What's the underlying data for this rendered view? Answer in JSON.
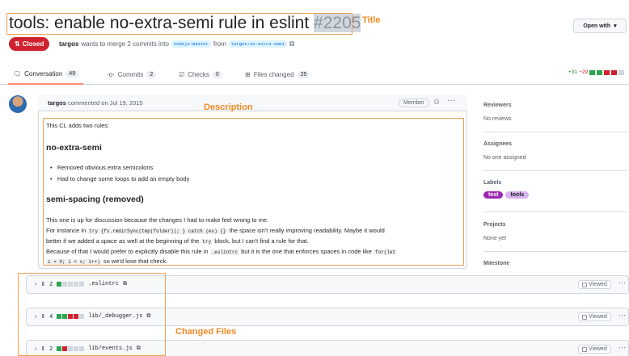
{
  "annotations": {
    "title": "Title",
    "description": "Description",
    "changed_files": "Changed Files"
  },
  "header": {
    "title": "tools: enable no-extra-semi rule in eslint",
    "number": "#2205",
    "open_with": "Open with",
    "status": "Closed",
    "author": "targos",
    "merge_text": "wants to merge 2 commits into",
    "base_branch": "nodejs:master",
    "from_text": "from",
    "head_branch": "targos:no-extra-semi"
  },
  "tabs": [
    {
      "label": "Conversation",
      "count": "49",
      "icon": "comment-icon"
    },
    {
      "label": "Commits",
      "count": "2",
      "icon": "commit-icon"
    },
    {
      "label": "Checks",
      "count": "0",
      "icon": "checks-icon"
    },
    {
      "label": "Files changed",
      "count": "25",
      "icon": "file-diff-icon"
    }
  ],
  "diffstat": {
    "additions": "+31",
    "deletions": "−29"
  },
  "comment": {
    "author": "targos",
    "action": "commented on Jul 19, 2015",
    "role": "Member",
    "intro": "This CL adds two rules:",
    "h1": "no-extra-semi",
    "bullets": [
      "Removed obvious extra semicolons",
      "Had to change some loops to add an empty body"
    ],
    "h2": "semi-spacing (removed)",
    "p1": "This one is up for discussion because the changes I had to make feel wrong to me.",
    "p2a": "For instance in",
    "p2code": "try {fs.rmdirSync(tmp(folder)); } catch (ex) {}",
    "p2b": "the space isn't really improving readability. Maybe it would",
    "p3a": "better if we added a space as well at the beginning of the",
    "p3code": "try",
    "p3b": "block, but I can't find a rule for that.",
    "p4a": "Because of that I would prefer to explicitly disable this rule in",
    "p4code": ".eslintrc",
    "p4b": "but it is the one that enforces spaces in code like",
    "p4code2": "for(let",
    "p5code": "i = 0; i < x; i++)",
    "p5b": "so we'd lose that check."
  },
  "sidebar": {
    "reviewers_title": "Reviewers",
    "reviewers_value": "No reviews",
    "assignees_title": "Assignees",
    "assignees_value": "No one assigned",
    "labels_title": "Labels",
    "labels": [
      {
        "name": "test",
        "bg": "#9c27b0",
        "fg": "#ffffff"
      },
      {
        "name": "tools",
        "bg": "#d8b4f0",
        "fg": "#1f2328"
      }
    ],
    "projects_title": "Projects",
    "projects_value": "None yet",
    "milestone_title": "Milestone"
  },
  "files": [
    {
      "changes": "2",
      "name": ".eslintrc",
      "viewed": "Viewed"
    },
    {
      "changes": "4",
      "name": "lib/_debugger.js",
      "viewed": "Viewed"
    },
    {
      "changes": "2",
      "name": "lib/events.js",
      "viewed": "Viewed"
    }
  ]
}
